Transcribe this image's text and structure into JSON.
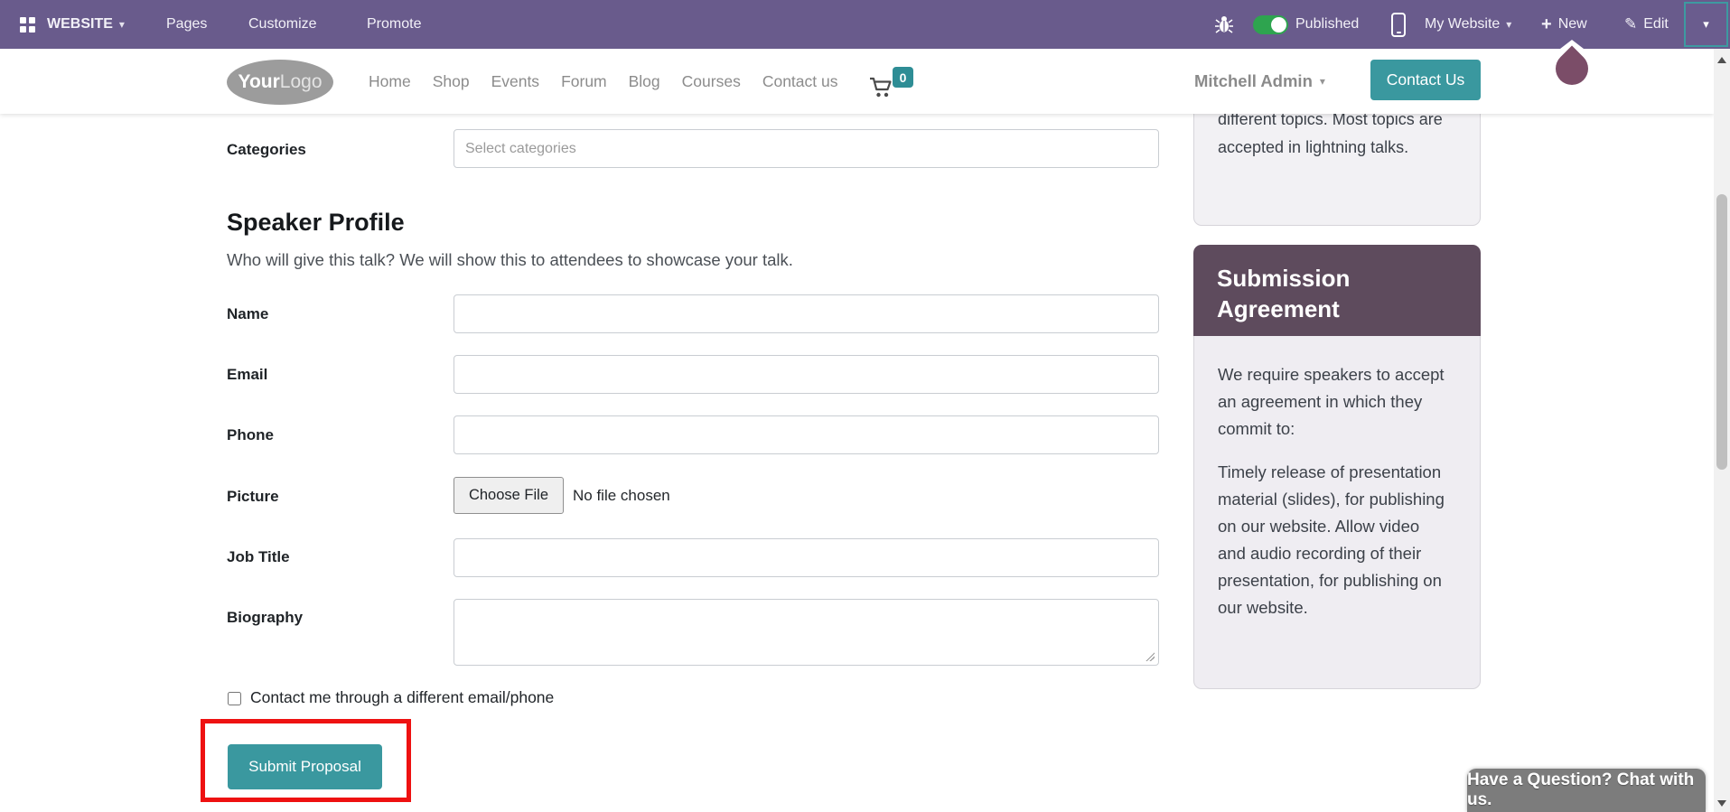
{
  "admin_bar": {
    "menu": [
      {
        "label": "WEBSITE"
      },
      {
        "label": "Pages"
      },
      {
        "label": "Customize"
      },
      {
        "label": "Promote"
      }
    ],
    "published_label": "Published",
    "my_website_label": "My Website",
    "new_label": "New",
    "edit_label": "Edit"
  },
  "site_header": {
    "logo_bold": "Your",
    "logo_light": "Logo",
    "nav": [
      {
        "label": "Home"
      },
      {
        "label": "Shop"
      },
      {
        "label": "Events"
      },
      {
        "label": "Forum"
      },
      {
        "label": "Blog"
      },
      {
        "label": "Courses"
      },
      {
        "label": "Contact us"
      }
    ],
    "cart_count": "0",
    "user_name": "Mitchell Admin",
    "contact_button_label": "Contact Us"
  },
  "form": {
    "categories_label": "Categories",
    "categories_placeholder": "Select categories",
    "section_title": "Speaker Profile",
    "section_subtitle": "Who will give this talk? We will show this to attendees to showcase your talk.",
    "name_label": "Name",
    "email_label": "Email",
    "phone_label": "Phone",
    "picture_label": "Picture",
    "file_button_label": "Choose File",
    "file_status": "No file chosen",
    "job_title_label": "Job Title",
    "biography_label": "Biography",
    "contact_checkbox_label": "Contact me through a different email/phone",
    "submit_label": "Submit Proposal"
  },
  "sidebar": {
    "info_card_text": "different topics. Most topics are accepted in lightning talks.",
    "agreement_title": "Submission Agreement",
    "agreement_p1": "We require speakers to accept an agreement in which they commit to:",
    "agreement_p2": "Timely release of presentation material (slides), for publishing on our website. Allow video and audio recording of their presentation, for publishing on our website."
  },
  "chat_widget": {
    "label": "Have a Question? Chat with us."
  },
  "icons": {
    "caret_down": "▾",
    "plus": "+",
    "pencil": "✎"
  },
  "colors": {
    "admin_bar_purple": "#695b8c",
    "accent_teal": "#3a989f",
    "toggle_green": "#2ea44f",
    "agreement_header_mauve": "#5e4b5d",
    "highlight_red": "#ee1111",
    "pointer_drop_purple": "#7b4d68",
    "chat_gray": "#7c7c7c",
    "cart_badge_teal": "#2e8d95"
  }
}
